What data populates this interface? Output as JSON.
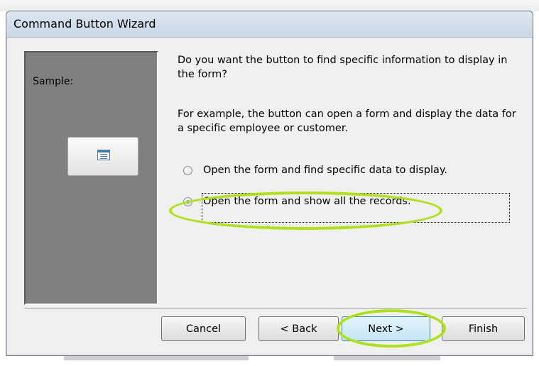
{
  "window": {
    "title": "Command Button Wizard"
  },
  "sample": {
    "label": "Sample:",
    "button_icon": "form-icon"
  },
  "text": {
    "question": "Do you want the button to find specific information to display in the form?",
    "example": "For example, the button can open a form and display the data for a specific employee or customer."
  },
  "options": [
    {
      "label": "Open the form and find specific data to display.",
      "selected": false
    },
    {
      "label": "Open the form and show all the records.",
      "selected": true
    }
  ],
  "buttons": {
    "cancel": "Cancel",
    "back": "< Back",
    "next": "Next >",
    "finish": "Finish"
  },
  "colors": {
    "highlight": "#aee11a",
    "sample_panel": "#808080",
    "dialog_bg": "#f0f0f0"
  }
}
